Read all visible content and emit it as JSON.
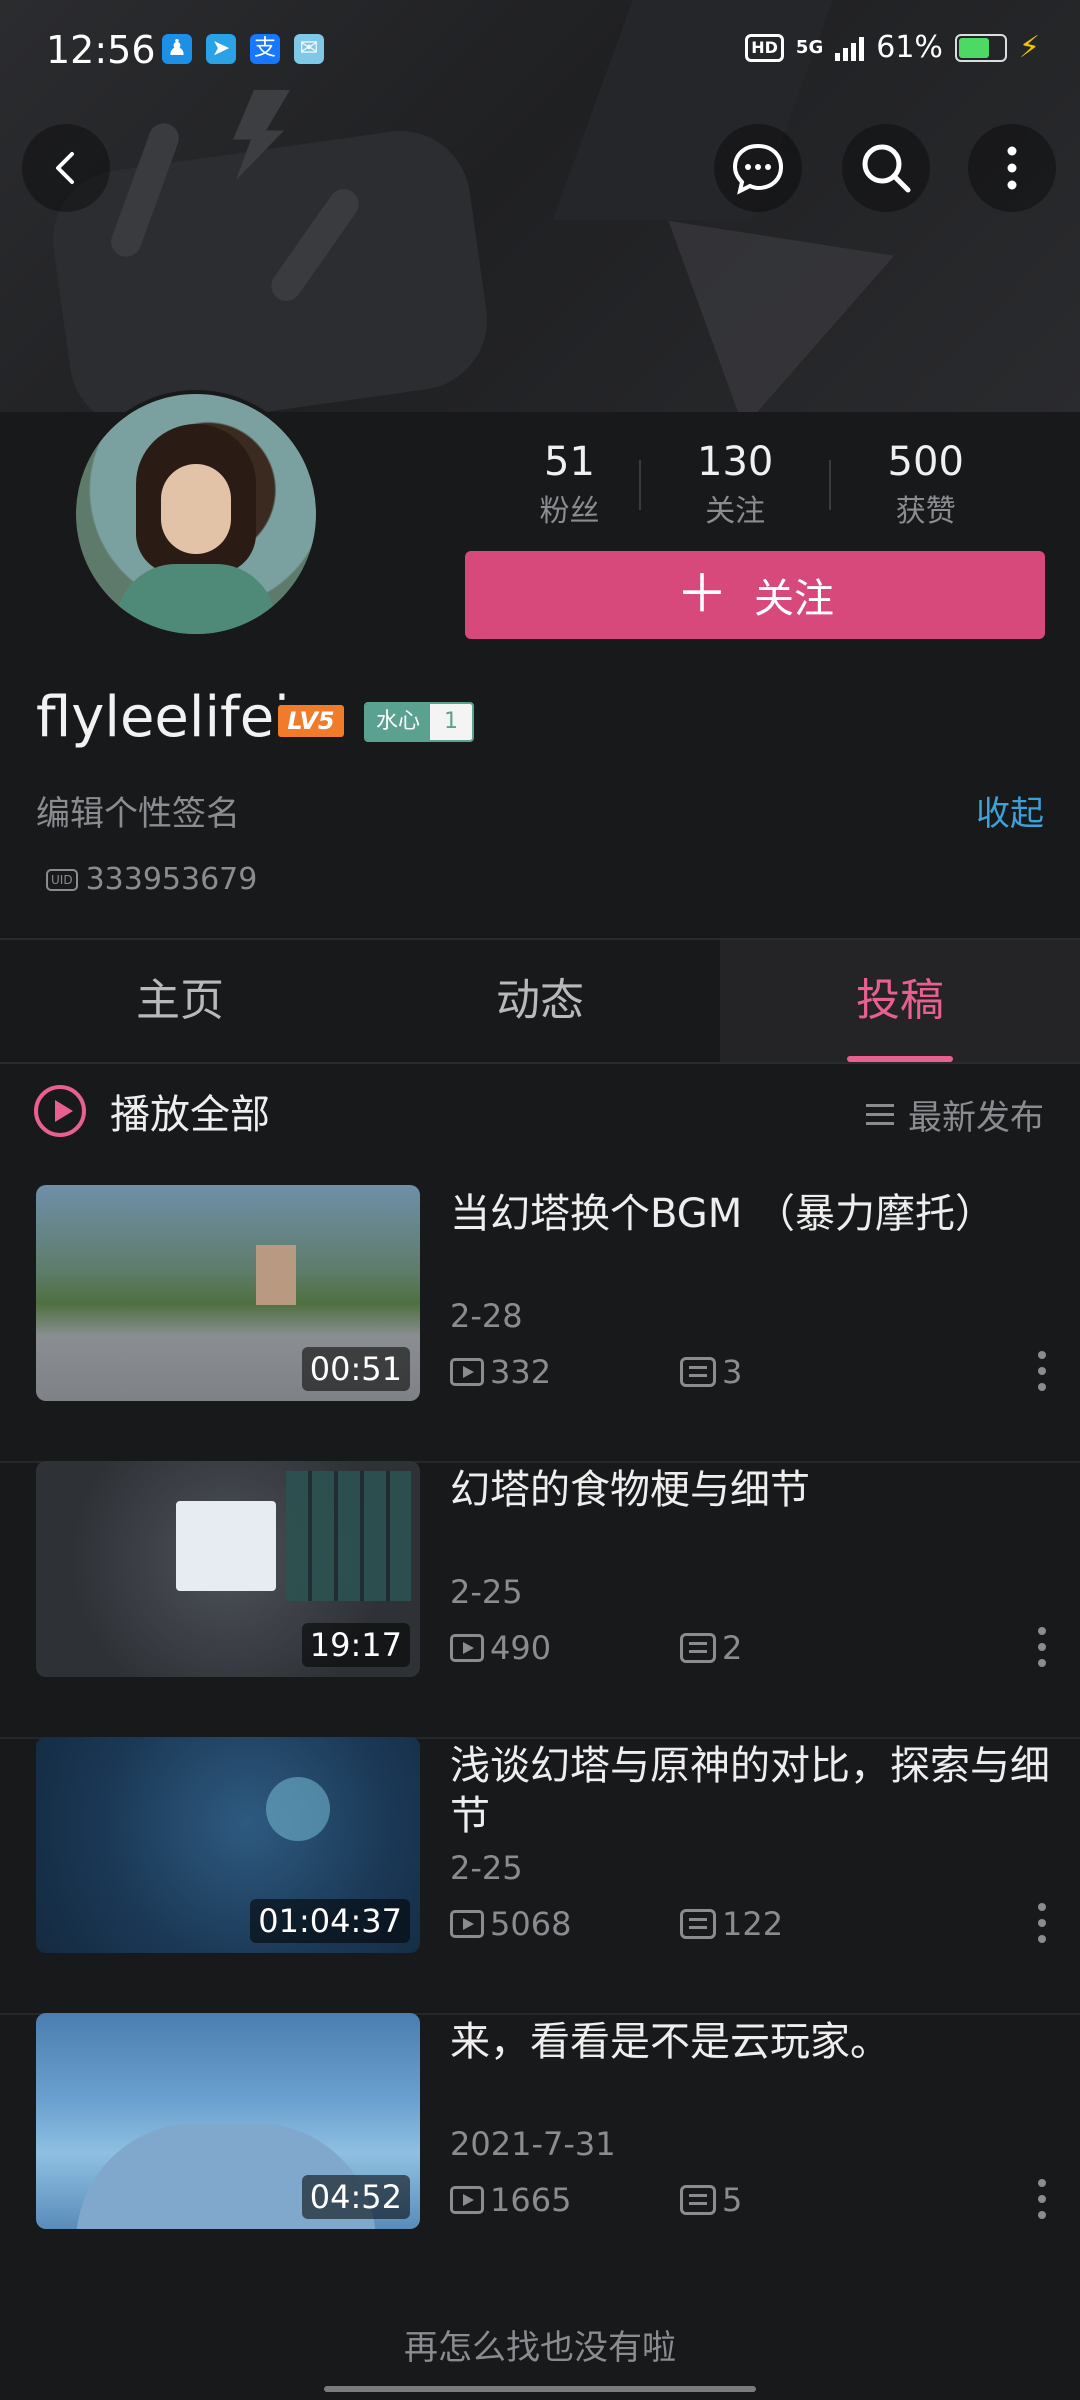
{
  "status": {
    "time": "12:56",
    "hd": "HD",
    "network": "5G",
    "battery": "61%",
    "battery_level": 0.61
  },
  "nav": {
    "back_icon": "chevron-left-icon",
    "message_icon": "chat-bubble-icon",
    "search_icon": "search-icon",
    "more_icon": "more-vertical-icon"
  },
  "profile": {
    "stats": [
      {
        "value": "51",
        "label": "粉丝"
      },
      {
        "value": "130",
        "label": "关注"
      },
      {
        "value": "500",
        "label": "获赞"
      }
    ],
    "follow_label": "关注",
    "username": "flyleelifei",
    "level_badge": "LV5",
    "fans_badge_name": "水心",
    "fans_badge_level": "1",
    "signature": "编辑个性签名",
    "collapse_label": "收起",
    "uid": "333953679"
  },
  "tabs": [
    {
      "label": "主页",
      "active": false
    },
    {
      "label": "动态",
      "active": false
    },
    {
      "label": "投稿",
      "active": true
    }
  ],
  "list_header": {
    "play_all": "播放全部",
    "sort_label": "最新发布"
  },
  "videos": [
    {
      "title": "当幻塔换个BGM （暴力摩托）",
      "duration": "00:51",
      "date": "2-28",
      "plays": "332",
      "comments": "3"
    },
    {
      "title": "幻塔的食物梗与细节",
      "duration": "19:17",
      "date": "2-25",
      "plays": "490",
      "comments": "2"
    },
    {
      "title": "浅谈幻塔与原神的对比，探索与细节",
      "duration": "01:04:37",
      "date": "2-25",
      "plays": "5068",
      "comments": "122"
    },
    {
      "title": "来，看看是不是云玩家。",
      "duration": "04:52",
      "date": "2021-7-31",
      "plays": "1665",
      "comments": "5"
    }
  ],
  "footer": "再怎么找也没有啦",
  "colors": {
    "accent": "#d6497a",
    "link": "#3ea0d8",
    "level": "#ef7b2b",
    "fans_badge": "#5aa28f"
  }
}
